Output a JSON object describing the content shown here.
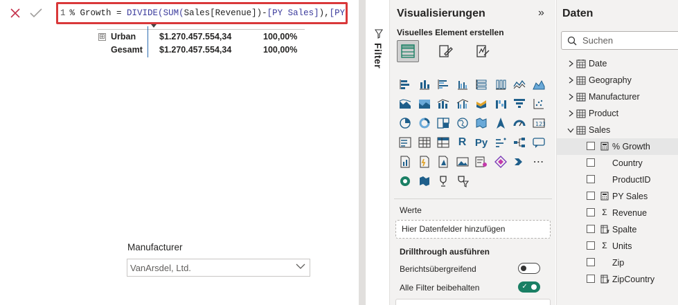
{
  "formula_bar": {
    "line_number": "1",
    "measure_name": "% Growth",
    "op": " = ",
    "fn_divide": "DIVIDE(",
    "fn_sum": "SUM(",
    "arg_revenue": "Sales[Revenue]",
    "mid": ")-",
    "arg_py1": "[PY Sales]",
    "comma": "),",
    "arg_py2": "[PY Sales]",
    "close": ")"
  },
  "table": {
    "rows": [
      {
        "label": "Urban",
        "value": "$1.270.457.554,34",
        "pct": "100,00%"
      },
      {
        "label": "Gesamt",
        "value": "$1.270.457.554,34",
        "pct": "100,00%"
      }
    ],
    "expand_symbol": "⊞"
  },
  "slicer": {
    "title": "Manufacturer",
    "selected": "VanArsdel, Ltd."
  },
  "filter_pane": {
    "label": "Filter"
  },
  "visualizations": {
    "title": "Visualisierungen",
    "collapse_symbol": "»",
    "subtitle": "Visuelles Element erstellen",
    "wells_label": "Werte",
    "dropzone_text": "Hier Datenfelder hinzufügen",
    "drillthrough_title": "Drillthrough ausführen",
    "option_cross_report": "Berichtsübergreifend",
    "option_keep_filters": "Alle Filter beibehalten",
    "cross_report_on": false,
    "keep_filters_on": true
  },
  "data_pane": {
    "title": "Daten",
    "search_placeholder": "Suchen",
    "tables": [
      {
        "name": "Date",
        "expanded": false
      },
      {
        "name": "Geography",
        "expanded": false
      },
      {
        "name": "Manufacturer",
        "expanded": false
      },
      {
        "name": "Product",
        "expanded": false
      },
      {
        "name": "Sales",
        "expanded": true
      }
    ],
    "sales_fields": [
      {
        "name": "% Growth",
        "icon": "calculator-icon",
        "selected": true
      },
      {
        "name": "Country",
        "icon": "",
        "selected": false
      },
      {
        "name": "ProductID",
        "icon": "",
        "selected": false
      },
      {
        "name": "PY Sales",
        "icon": "calculator-icon",
        "selected": false
      },
      {
        "name": "Revenue",
        "icon": "sigma-icon",
        "selected": false
      },
      {
        "name": "Spalte",
        "icon": "calculated-column-icon",
        "selected": false
      },
      {
        "name": "Units",
        "icon": "sigma-icon",
        "selected": false
      },
      {
        "name": "Zip",
        "icon": "",
        "selected": false
      },
      {
        "name": "ZipCountry",
        "icon": "calculated-column-icon",
        "selected": false
      }
    ]
  },
  "colors": {
    "highlight_red": "#d9383a",
    "accent_green": "#1a7f64",
    "pane_bg": "#f3f2f1"
  }
}
